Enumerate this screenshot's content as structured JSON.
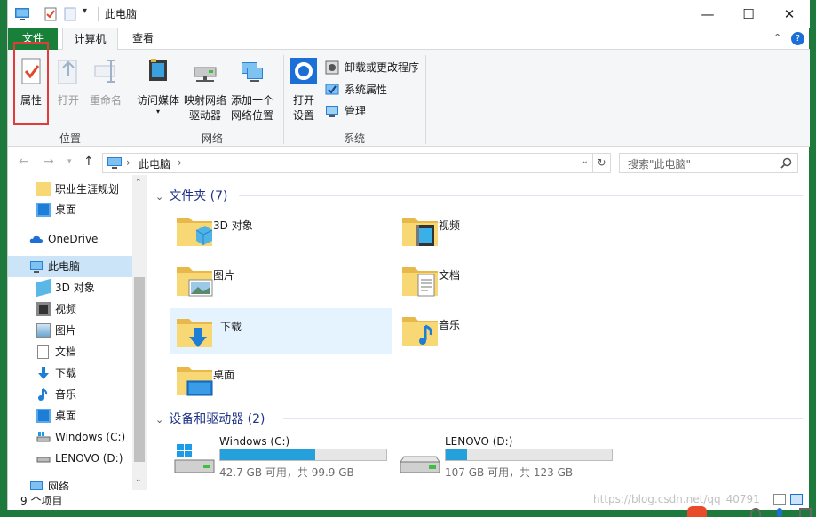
{
  "window": {
    "title": "此电脑",
    "minimize": "—",
    "maximize": "☐",
    "close": "✕"
  },
  "tabs": {
    "file": "文件",
    "computer": "计算机",
    "view": "查看",
    "collapse": "^",
    "help": "?"
  },
  "ribbon": {
    "location": {
      "label": "位置",
      "properties": "属性",
      "open": "打开",
      "rename": "重命名"
    },
    "network": {
      "label": "网络",
      "media": "访问媒体",
      "map_drive_1": "映射网络",
      "map_drive_2": "驱动器",
      "add_loc_1": "添加一个",
      "add_loc_2": "网络位置"
    },
    "system": {
      "label": "系统",
      "open_settings_1": "打开",
      "open_settings_2": "设置",
      "uninstall": "卸载或更改程序",
      "sys_props": "系统属性",
      "manage": "管理"
    }
  },
  "address": {
    "path": "此电脑",
    "sep": "›",
    "search_placeholder": "搜索\"此电脑\""
  },
  "sidebar": {
    "items": [
      {
        "label": "职业生涯规划"
      },
      {
        "label": "桌面"
      },
      {
        "label": "OneDrive"
      },
      {
        "label": "此电脑"
      },
      {
        "label": "3D 对象"
      },
      {
        "label": "视频"
      },
      {
        "label": "图片"
      },
      {
        "label": "文档"
      },
      {
        "label": "下载"
      },
      {
        "label": "音乐"
      },
      {
        "label": "桌面"
      },
      {
        "label": "Windows (C:)"
      },
      {
        "label": "LENOVO (D:)"
      },
      {
        "label": "网络"
      }
    ]
  },
  "content": {
    "folders_header": "文件夹 (7)",
    "folders": [
      "3D 对象",
      "视频",
      "图片",
      "文档",
      "下载",
      "音乐",
      "桌面"
    ],
    "drives_header": "设备和驱动器 (2)",
    "drives": [
      {
        "name": "Windows (C:)",
        "detail": "42.7 GB 可用，共 99.9 GB",
        "used_fraction": 0.573
      },
      {
        "name": "LENOVO (D:)",
        "detail": "107 GB 可用，共 123 GB",
        "used_fraction": 0.13
      }
    ]
  },
  "status": {
    "count": "9 个项目",
    "watermark": "https://blog.csdn.net/qq_40791"
  },
  "colors": {
    "file_tab": "#19803a",
    "selection": "#cce4f7",
    "drive_fill": "#26a0da",
    "highlight": "#e23b3b"
  }
}
